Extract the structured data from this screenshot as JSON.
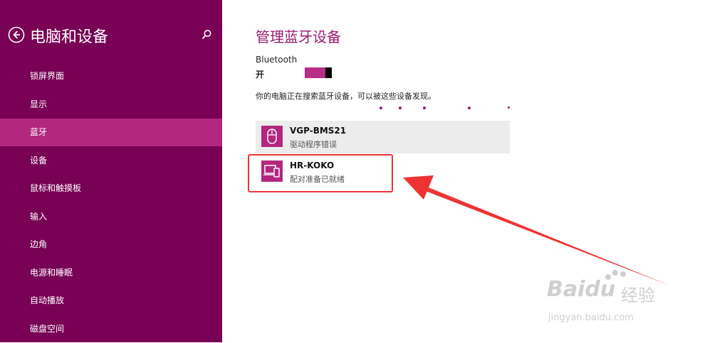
{
  "sidebar": {
    "title": "电脑和设备",
    "items": [
      {
        "label": "锁屏界面"
      },
      {
        "label": "显示"
      },
      {
        "label": "蓝牙",
        "selected": true
      },
      {
        "label": "设备"
      },
      {
        "label": "鼠标和触摸板"
      },
      {
        "label": "输入"
      },
      {
        "label": "边角"
      },
      {
        "label": "电源和睡眠"
      },
      {
        "label": "自动播放"
      },
      {
        "label": "磁盘空间"
      }
    ]
  },
  "main": {
    "title": "管理蓝牙设备",
    "bluetooth_label": "Bluetooth",
    "bluetooth_state": "开",
    "bluetooth_on": true,
    "searching_text": "你的电脑正在搜索蓝牙设备，可以被这些设备发现。",
    "devices": [
      {
        "name": "VGP-BMS21",
        "status": "驱动程序错误",
        "icon": "mouse-icon"
      },
      {
        "name": "HR-KOKO",
        "status": "配对准备已就绪",
        "icon": "phone-laptop-icon"
      }
    ]
  },
  "watermark": {
    "brand": "Baidu",
    "cn": "经验",
    "url": "jingyan.baidu.com"
  },
  "colors": {
    "sidebar_bg": "#780055",
    "selected_bg": "#b3277f",
    "accent": "#9c1a72",
    "annotation": "#ee3333"
  }
}
